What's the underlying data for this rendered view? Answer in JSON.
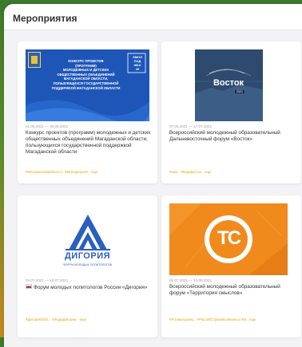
{
  "page": {
    "title": "Мероприятия"
  },
  "cards": [
    {
      "dates": "01.06.2021 — 30.06.2021",
      "title": "Конкурс проектов (программ) молодежных и детских общественных объединений Магаданской области, пользующихся государственной поддержкой Магаданской области",
      "tags": [
        "#МагаданскаяОбласть",
        "#Молодежь49,",
        "еще"
      ],
      "image": {
        "line1": "КОНКУРС ПРОЕКТОВ",
        "line2": "(ПРОГРАММ)",
        "line3": "МОЛОДЕЖНЫХ И ДЕТСКИХ",
        "line4": "ОБЩЕСТВЕННЫХ ОБЪЕДИНЕНИЙ",
        "line5": "МАГАДАНСКОЙ ОБЛАСТИ,",
        "line6": "ПОЛЬЗУЮЩИХСЯ ГОСУДАРСТВЕННОЙ",
        "line7": "ПОДДЕРЖКОЙ МАГАДАНСКОЙ ОБЛАСТИ",
        "badge1": "ЭМОЛ",
        "badge2": "ПОД",
        "badge3": "ЖКА",
        "badge4": "49"
      }
    },
    {
      "dates": "07.06.2021 — 17.07.2021",
      "title": "Всероссийский молодежный образовательный Дальневосточный форум «Восток»",
      "tags": [
        "#ямп,",
        "#вадивосток,",
        "еще"
      ],
      "image": {
        "logo": "Восток",
        "sub": "2021"
      }
    },
    {
      "dates": "04.07.2021 — 10.07.2021",
      "title": "Форум молодых политологов России «Дигория»",
      "tags": [
        "#Дигория2021,",
        "#ЛюдиДигории,",
        "еще"
      ],
      "image": {
        "logo": "ДИГОРИЯ",
        "sub": "ФОРУМ МОЛОДЫХ ПОЛИТОЛОГОВ"
      }
    },
    {
      "dates": "05.07.2021 — 13.08.2021",
      "title": "Всероссийский молодежный образовательный форум «Территория смыслов»",
      "tags": [
        "#Росмолодежь,",
        "#РоссияСтранаВозможностей,",
        "еще"
      ],
      "image": {
        "logo": "ТС"
      }
    }
  ],
  "colors": {
    "accent": "#f2a20a",
    "card1_bg": "#1e56b8",
    "card2_bg": "#2e4a6e",
    "card3_logo": "#2a5fc0",
    "card4_bg": "#f08a1c"
  }
}
